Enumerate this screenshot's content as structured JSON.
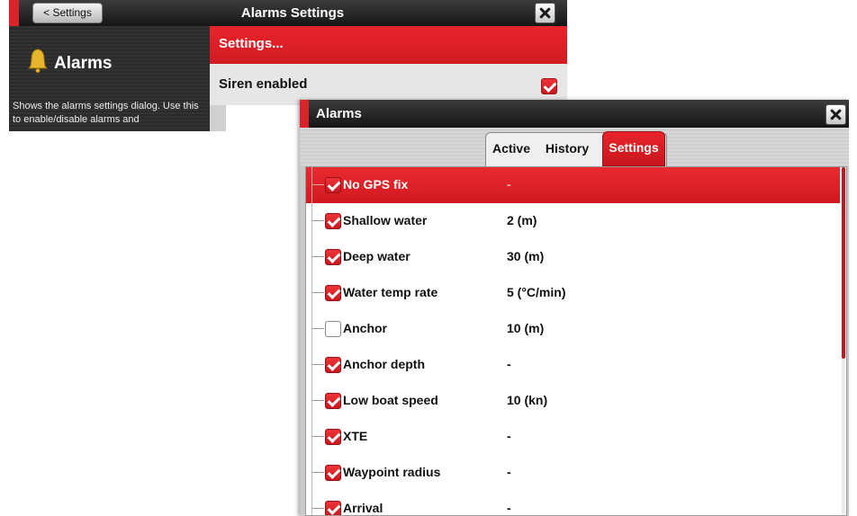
{
  "back_window": {
    "back_button": "< Settings",
    "title": "Alarms Settings",
    "left_panel": {
      "icon": "bell-icon",
      "heading": "Alarms",
      "description": "Shows the alarms settings dialog. Use this to enable/disable alarms and"
    },
    "menu": {
      "settings_label": "Settings...",
      "siren_label": "Siren enabled",
      "siren_checked": true
    }
  },
  "alarms_dialog": {
    "title": "Alarms",
    "tabs": [
      {
        "label": "Active",
        "selected": false
      },
      {
        "label": "History",
        "selected": false
      },
      {
        "label": "Settings",
        "selected": true
      }
    ],
    "rows": [
      {
        "label": "No GPS fix",
        "value": "-",
        "checked": true,
        "selected": true
      },
      {
        "label": "Shallow water",
        "value": "2 (m)",
        "checked": true,
        "selected": false
      },
      {
        "label": "Deep water",
        "value": "30 (m)",
        "checked": true,
        "selected": false
      },
      {
        "label": "Water temp rate",
        "value": "5 (°C/min)",
        "checked": true,
        "selected": false
      },
      {
        "label": "Anchor",
        "value": "10 (m)",
        "checked": false,
        "selected": false
      },
      {
        "label": "Anchor depth",
        "value": "-",
        "checked": true,
        "selected": false
      },
      {
        "label": "Low boat speed",
        "value": "10 (kn)",
        "checked": true,
        "selected": false
      },
      {
        "label": "XTE",
        "value": "-",
        "checked": true,
        "selected": false
      },
      {
        "label": "Waypoint radius",
        "value": "-",
        "checked": true,
        "selected": false
      },
      {
        "label": "Arrival",
        "value": "-",
        "checked": true,
        "selected": false
      }
    ],
    "scroll": {
      "start_fraction": 0.0,
      "visible_fraction": 0.55
    }
  },
  "colors": {
    "accent_red": "#d9232a",
    "titlebar_dark": "#1e1e1e"
  }
}
